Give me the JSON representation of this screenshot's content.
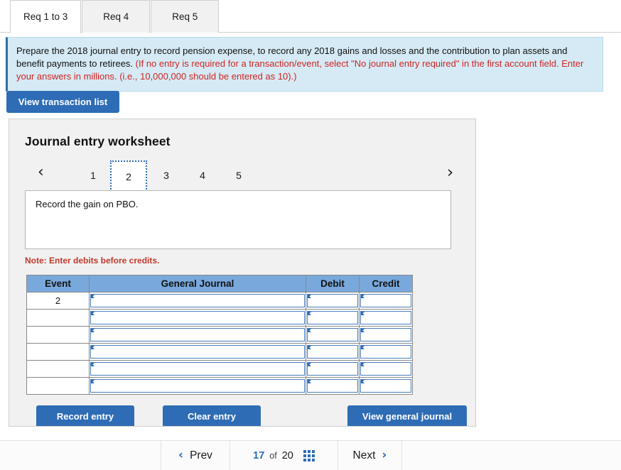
{
  "tabs": [
    {
      "label": "Req 1 to 3",
      "active": true
    },
    {
      "label": "Req 4",
      "active": false
    },
    {
      "label": "Req 5",
      "active": false
    }
  ],
  "instruction": {
    "black_text": "Prepare the 2018 journal entry to record pension expense, to record any 2018 gains and losses and the contribution to plan assets and benefit payments to retirees. ",
    "red_text": "(If no entry is required for a transaction/event, select \"No journal entry required\" in the first account field. Enter your answers in millions. (i.e., 10,000,000 should be entered as 10).)"
  },
  "toolbar": {
    "view_transaction_list_label": "View transaction list"
  },
  "worksheet": {
    "title": "Journal entry worksheet",
    "pager": {
      "prev_icon": "‹",
      "next_icon": "›",
      "pages": [
        "1",
        "2",
        "3",
        "4",
        "5"
      ],
      "active_page": "2"
    },
    "description": "Record the gain on PBO.",
    "note": "Note: Enter debits before credits.",
    "table": {
      "headers": [
        "Event",
        "General Journal",
        "Debit",
        "Credit"
      ],
      "rows": [
        {
          "event": "2",
          "general_journal": "",
          "debit": "",
          "credit": ""
        },
        {
          "event": "",
          "general_journal": "",
          "debit": "",
          "credit": ""
        },
        {
          "event": "",
          "general_journal": "",
          "debit": "",
          "credit": ""
        },
        {
          "event": "",
          "general_journal": "",
          "debit": "",
          "credit": ""
        },
        {
          "event": "",
          "general_journal": "",
          "debit": "",
          "credit": ""
        },
        {
          "event": "",
          "general_journal": "",
          "debit": "",
          "credit": ""
        }
      ]
    },
    "actions": {
      "record_label": "Record entry",
      "clear_label": "Clear entry",
      "view_journal_label": "View general journal"
    }
  },
  "bottom_nav": {
    "prev_label": "Prev",
    "prev_icon": "‹",
    "current_page": "17",
    "of_label": "of",
    "total_pages": "20",
    "grid_icon": "grid-icon",
    "next_label": "Next",
    "next_icon": "›"
  },
  "colors": {
    "accent_blue": "#2e6cb5",
    "table_header_blue": "#79a8dc",
    "instruction_bg": "#d5eaf4",
    "warning_red": "#c0392b"
  }
}
